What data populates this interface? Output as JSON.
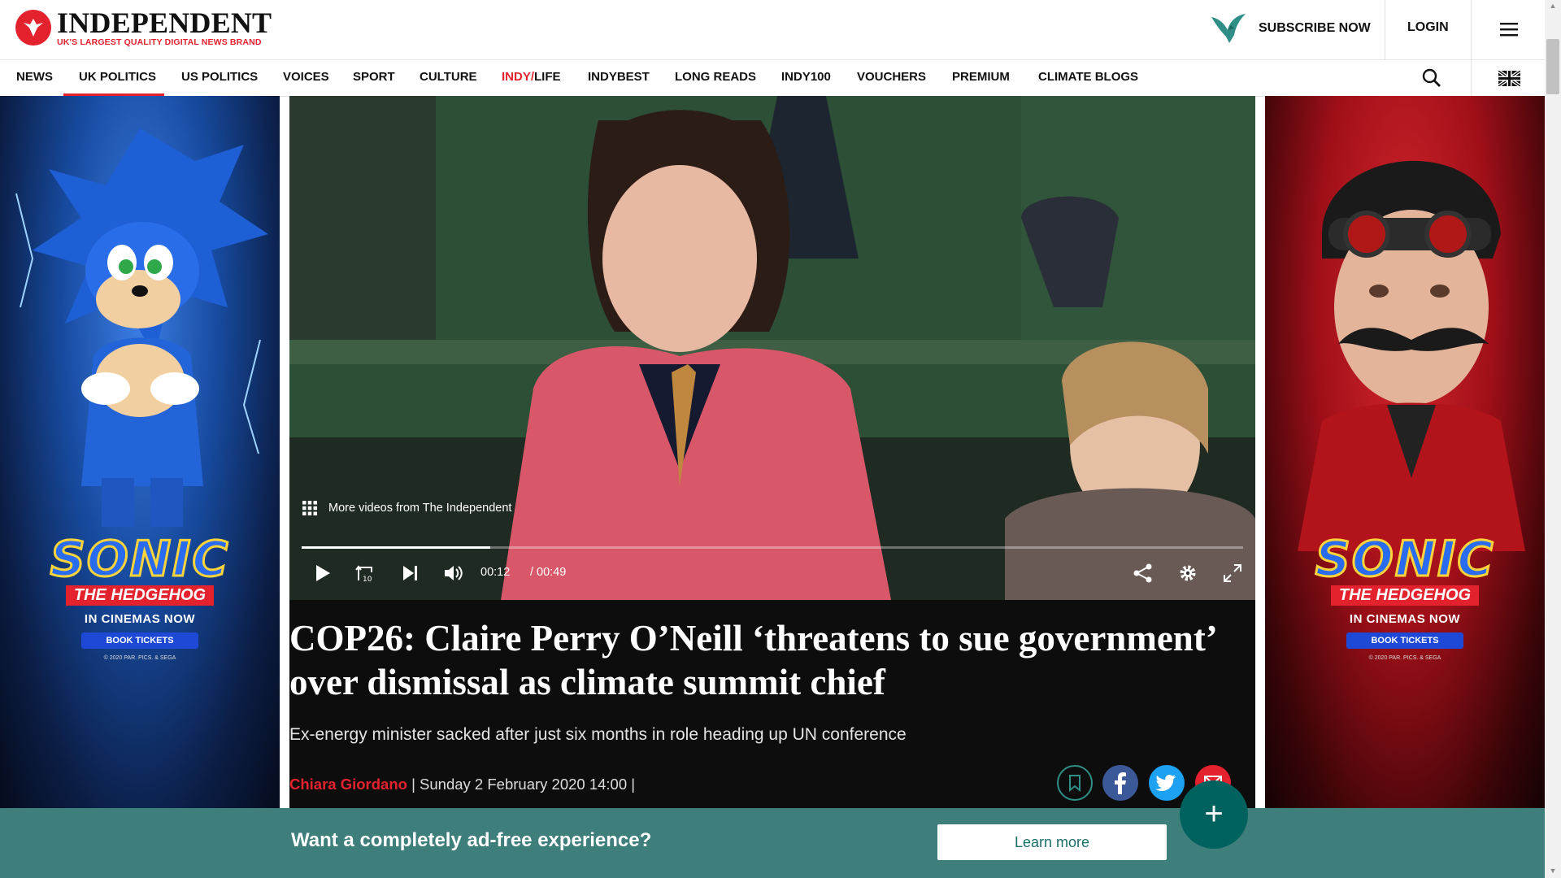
{
  "brand": {
    "name": "INDEPENDENT",
    "tagline": "UK'S LARGEST QUALITY DIGITAL NEWS BRAND",
    "red": "#e4222e"
  },
  "header": {
    "subscribe_label": "SUBSCRIBE NOW",
    "login_label": "LOGIN"
  },
  "nav": {
    "items": [
      {
        "label": "NEWS"
      },
      {
        "label": "UK POLITICS",
        "active": true
      },
      {
        "label": "US POLITICS"
      },
      {
        "label": "VOICES"
      },
      {
        "label": "SPORT"
      },
      {
        "label": "CULTURE"
      },
      {
        "label_red": "INDY/",
        "label_rest": "LIFE"
      },
      {
        "label": "INDYBEST"
      },
      {
        "label": "LONG READS"
      },
      {
        "label": "INDY100"
      },
      {
        "label": "VOUCHERS"
      },
      {
        "label": "PREMIUM"
      },
      {
        "label": "CLIMATE BLOGS"
      }
    ]
  },
  "ads": {
    "left": {
      "title": "SONIC",
      "subtitle": "THE HEDGEHOG",
      "cinemas": "IN CINEMAS NOW",
      "tickets": "BOOK TICKETS",
      "copyright": "© 2020 PAR. PICS. & SEGA"
    },
    "right": {
      "title": "SONIC",
      "subtitle": "THE HEDGEHOG",
      "cinemas": "IN CINEMAS NOW",
      "tickets": "BOOK TICKETS",
      "copyright": "© 2020 PAR. PICS. & SEGA"
    }
  },
  "video": {
    "more_videos": "More videos from The Independent",
    "current_time": "00:12",
    "duration": "/ 00:49",
    "progress_fraction": 0.2
  },
  "article": {
    "headline": "COP26: Claire Perry O’Neill ‘threatens to sue government’ over dismissal as climate summit chief",
    "standfirst": "Ex-energy minister sacked after just six months in role heading up UN conference",
    "author": "Chiara Giordano",
    "date_sep": " | ",
    "date": "Sunday 2 February 2020 14:00",
    "trailing_sep": " |"
  },
  "banner": {
    "text": "Want a completely ad-free experience?",
    "button": "Learn more"
  },
  "fab_label": "+"
}
